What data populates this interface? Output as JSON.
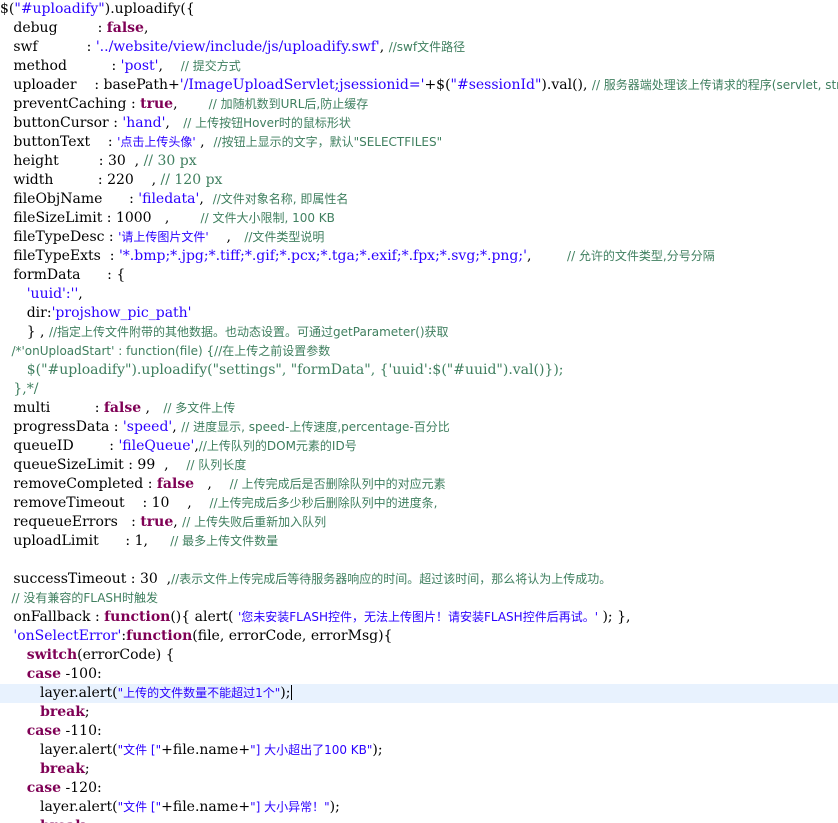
{
  "editor": {
    "lines": [
      [
        {
          "t": "$(",
          "c": "plain"
        },
        {
          "t": "\"#uploadify\"",
          "c": "string"
        },
        {
          "t": ").uploadify({",
          "c": "plain"
        }
      ],
      [
        {
          "t": "   debug         : ",
          "c": "plain"
        },
        {
          "t": "false",
          "c": "kw"
        },
        {
          "t": ",",
          "c": "plain"
        }
      ],
      [
        {
          "t": "   swf           : ",
          "c": "plain"
        },
        {
          "t": "'../website/view/include/js/uploadify.swf'",
          "c": "string"
        },
        {
          "t": ", ",
          "c": "plain"
        },
        {
          "t": "//swf文件路径",
          "c": "comment"
        }
      ],
      [
        {
          "t": "   method          : ",
          "c": "plain"
        },
        {
          "t": "'post'",
          "c": "string"
        },
        {
          "t": ",    ",
          "c": "plain"
        },
        {
          "t": "// 提交方式",
          "c": "comment"
        }
      ],
      [
        {
          "t": "   uploader    : basePath+",
          "c": "plain"
        },
        {
          "t": "'/ImageUploadServlet;jsessionid='",
          "c": "string"
        },
        {
          "t": "+$(",
          "c": "plain"
        },
        {
          "t": "\"#sessionId\"",
          "c": "string"
        },
        {
          "t": ").val(), ",
          "c": "plain"
        },
        {
          "t": "// 服务器端处理该上传请求的程序(servlet, str",
          "c": "comment"
        }
      ],
      [
        {
          "t": "   preventCaching : ",
          "c": "plain"
        },
        {
          "t": "true",
          "c": "kw"
        },
        {
          "t": ",       ",
          "c": "plain"
        },
        {
          "t": "// 加随机数到URL后,防止缓存",
          "c": "comment"
        }
      ],
      [
        {
          "t": "   buttonCursor : ",
          "c": "plain"
        },
        {
          "t": "'hand'",
          "c": "string"
        },
        {
          "t": ",   ",
          "c": "plain"
        },
        {
          "t": "// 上传按钮Hover时的鼠标形状",
          "c": "comment"
        }
      ],
      [
        {
          "t": "   buttonText    : ",
          "c": "plain"
        },
        {
          "t": "'点击上传头像'",
          "c": "string"
        },
        {
          "t": " ,  ",
          "c": "plain"
        },
        {
          "t": "//按钮上显示的文字，默认\"SELECTFILES\"",
          "c": "comment"
        }
      ],
      [
        {
          "t": "   height         : 30  , ",
          "c": "plain"
        },
        {
          "t": "// 30 px",
          "c": "comment"
        }
      ],
      [
        {
          "t": "   width          : 220    , ",
          "c": "plain"
        },
        {
          "t": "// 120 px",
          "c": "comment"
        }
      ],
      [
        {
          "t": "   fileObjName      : ",
          "c": "plain"
        },
        {
          "t": "'filedata'",
          "c": "string"
        },
        {
          "t": ",  ",
          "c": "plain"
        },
        {
          "t": "//文件对象名称, 即属性名",
          "c": "comment"
        }
      ],
      [
        {
          "t": "   fileSizeLimit : 1000   ,       ",
          "c": "plain"
        },
        {
          "t": "// 文件大小限制, 100 KB",
          "c": "comment"
        }
      ],
      [
        {
          "t": "   fileTypeDesc : ",
          "c": "plain"
        },
        {
          "t": "'请上传图片文件'",
          "c": "string"
        },
        {
          "t": "    ,   ",
          "c": "plain"
        },
        {
          "t": "//文件类型说明",
          "c": "comment"
        }
      ],
      [
        {
          "t": "   fileTypeExts  : ",
          "c": "plain"
        },
        {
          "t": "'*.bmp;*.jpg;*.tiff;*.gif;*.pcx;*.tga;*.exif;*.fpx;*.svg;*.png;'",
          "c": "string"
        },
        {
          "t": ",        ",
          "c": "plain"
        },
        {
          "t": "// 允许的文件类型,分号分隔",
          "c": "comment"
        }
      ],
      [
        {
          "t": "   formData      : {",
          "c": "plain"
        }
      ],
      [
        {
          "t": "      ",
          "c": "plain"
        },
        {
          "t": "'uuid':''",
          "c": "string"
        },
        {
          "t": ",",
          "c": "plain"
        }
      ],
      [
        {
          "t": "      dir:",
          "c": "plain"
        },
        {
          "t": "'projshow_pic_path'",
          "c": "string"
        }
      ],
      [
        {
          "t": "      } , ",
          "c": "plain"
        },
        {
          "t": "//指定上传文件附带的其他数据。也动态设置。可通过getParameter()获取",
          "c": "comment"
        }
      ],
      [
        {
          "t": "   /*'onUploadStart' : function(file) {//在上传之前设置参数",
          "c": "comment"
        }
      ],
      [
        {
          "t": "      $(\"#uploadify\").uploadify(\"settings\", \"formData\", {'uuid':$(\"#uuid\").val()});",
          "c": "comment"
        }
      ],
      [
        {
          "t": "   },*/",
          "c": "comment"
        }
      ],
      [
        {
          "t": "   multi          : ",
          "c": "plain"
        },
        {
          "t": "false",
          "c": "kw"
        },
        {
          "t": " ,   ",
          "c": "plain"
        },
        {
          "t": "// 多文件上传",
          "c": "comment"
        }
      ],
      [
        {
          "t": "   progressData : ",
          "c": "plain"
        },
        {
          "t": "'speed'",
          "c": "string"
        },
        {
          "t": ", ",
          "c": "plain"
        },
        {
          "t": "// 进度显示, speed-上传速度,percentage-百分比",
          "c": "comment"
        }
      ],
      [
        {
          "t": "   queueID        : ",
          "c": "plain"
        },
        {
          "t": "'fileQueue'",
          "c": "string"
        },
        {
          "t": ",",
          "c": "plain"
        },
        {
          "t": "//上传队列的DOM元素的ID号",
          "c": "comment"
        }
      ],
      [
        {
          "t": "   queueSizeLimit : 99  ,    ",
          "c": "plain"
        },
        {
          "t": "// 队列长度",
          "c": "comment"
        }
      ],
      [
        {
          "t": "   removeCompleted : ",
          "c": "plain"
        },
        {
          "t": "false",
          "c": "kw"
        },
        {
          "t": "   ,    ",
          "c": "plain"
        },
        {
          "t": "// 上传完成后是否删除队列中的对应元素",
          "c": "comment"
        }
      ],
      [
        {
          "t": "   removeTimeout    : 10    ,    ",
          "c": "plain"
        },
        {
          "t": "//上传完成后多少秒后删除队列中的进度条,",
          "c": "comment"
        }
      ],
      [
        {
          "t": "   requeueErrors   : ",
          "c": "plain"
        },
        {
          "t": "true",
          "c": "kw"
        },
        {
          "t": ", ",
          "c": "plain"
        },
        {
          "t": "// 上传失败后重新加入队列",
          "c": "comment"
        }
      ],
      [
        {
          "t": "   uploadLimit      : 1,     ",
          "c": "plain"
        },
        {
          "t": "// 最多上传文件数量",
          "c": "comment"
        }
      ],
      [],
      [
        {
          "t": "   successTimeout : 30  ,",
          "c": "plain"
        },
        {
          "t": "//表示文件上传完成后等待服务器响应的时间。超过该时间，那么将认为上传成功。",
          "c": "comment"
        }
      ],
      [
        {
          "t": "   // 没有兼容的FLASH时触发",
          "c": "comment"
        }
      ],
      [
        {
          "t": "   onFallback : ",
          "c": "plain"
        },
        {
          "t": "function",
          "c": "kw"
        },
        {
          "t": "(){ alert( ",
          "c": "plain"
        },
        {
          "t": "'您未安装FLASH控件，无法上传图片！请安装FLASH控件后再试。'",
          "c": "string"
        },
        {
          "t": " ); },",
          "c": "plain"
        }
      ],
      [
        {
          "t": "   ",
          "c": "plain"
        },
        {
          "t": "'onSelectError'",
          "c": "string"
        },
        {
          "t": ":",
          "c": "plain"
        },
        {
          "t": "function",
          "c": "kw"
        },
        {
          "t": "(file, errorCode, errorMsg){",
          "c": "plain"
        }
      ],
      [
        {
          "t": "      ",
          "c": "plain"
        },
        {
          "t": "switch",
          "c": "kw"
        },
        {
          "t": "(errorCode) {",
          "c": "plain"
        }
      ],
      [
        {
          "t": "      ",
          "c": "plain"
        },
        {
          "t": "case",
          "c": "kw"
        },
        {
          "t": " -100:",
          "c": "plain"
        }
      ],
      [
        {
          "t": "         layer.alert(",
          "c": "plain"
        },
        {
          "t": "\"上传的文件数量不能超过1个\"",
          "c": "string"
        },
        {
          "t": ");",
          "c": "plain"
        }
      ],
      [
        {
          "t": "         ",
          "c": "plain"
        },
        {
          "t": "break",
          "c": "kw"
        },
        {
          "t": ";",
          "c": "plain"
        }
      ],
      [
        {
          "t": "      ",
          "c": "plain"
        },
        {
          "t": "case",
          "c": "kw"
        },
        {
          "t": " -110:",
          "c": "plain"
        }
      ],
      [
        {
          "t": "         layer.alert(",
          "c": "plain"
        },
        {
          "t": "\"文件 [\"",
          "c": "string"
        },
        {
          "t": "+file.name+",
          "c": "plain"
        },
        {
          "t": "\"] 大小超出了100 KB\"",
          "c": "string"
        },
        {
          "t": ");",
          "c": "plain"
        }
      ],
      [
        {
          "t": "         ",
          "c": "plain"
        },
        {
          "t": "break",
          "c": "kw"
        },
        {
          "t": ";",
          "c": "plain"
        }
      ],
      [
        {
          "t": "      ",
          "c": "plain"
        },
        {
          "t": "case",
          "c": "kw"
        },
        {
          "t": " -120:",
          "c": "plain"
        }
      ],
      [
        {
          "t": "         layer.alert(",
          "c": "plain"
        },
        {
          "t": "\"文件 [\"",
          "c": "string"
        },
        {
          "t": "+file.name+",
          "c": "plain"
        },
        {
          "t": "\"] 大小异常！\"",
          "c": "string"
        },
        {
          "t": ");",
          "c": "plain"
        }
      ],
      [
        {
          "t": "         ",
          "c": "plain"
        },
        {
          "t": "break",
          "c": "kw"
        },
        {
          "t": ";",
          "c": "plain"
        }
      ]
    ],
    "current_line": 36
  }
}
